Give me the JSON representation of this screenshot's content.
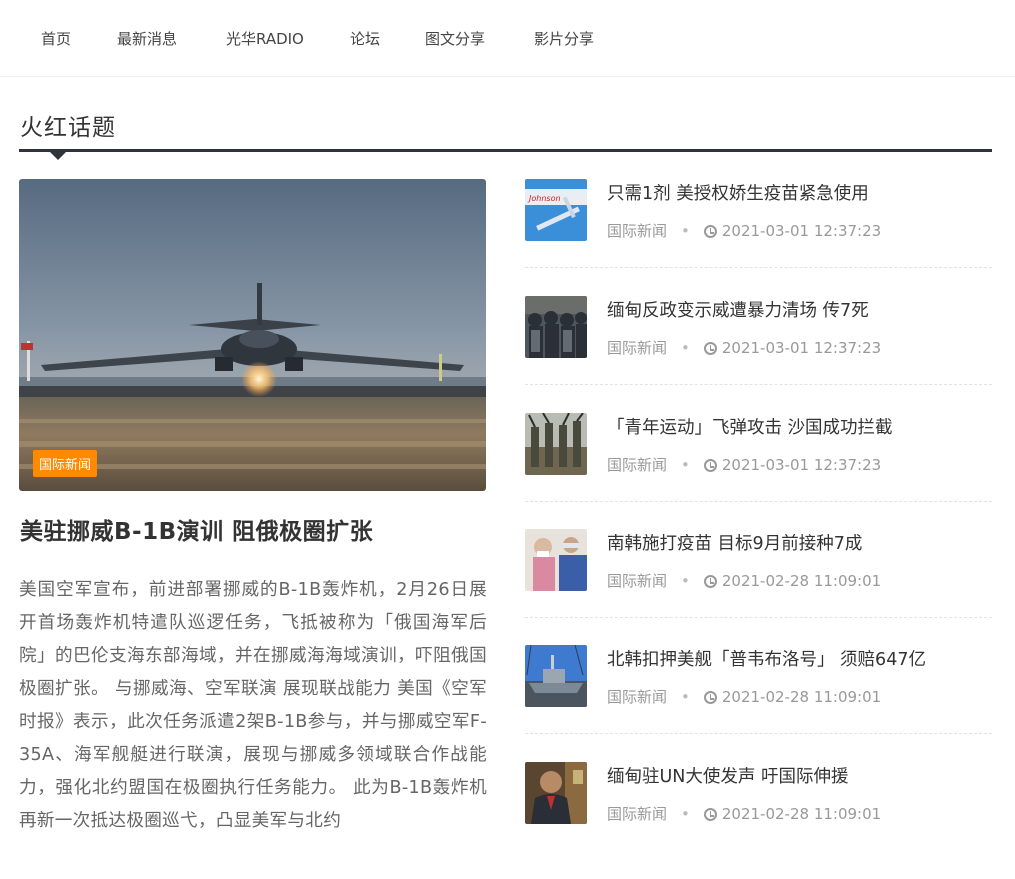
{
  "nav": [
    "首页",
    "最新消息",
    "光华RADIO",
    "论坛",
    "图文分享",
    "影片分享"
  ],
  "section": {
    "title": "火红话题"
  },
  "hero": {
    "badge": "国际新闻",
    "title": "美驻挪威B-1B演训  阻俄极圈扩张",
    "body": "美国空军宣布，前进部署挪威的B-1B轰炸机，2月26日展开首场轰炸机特遣队巡逻任务，飞抵被称为「俄国海军后院」的巴伦支海东部海域，并在挪威海海域演训，吓阻俄国极圈扩张。    与挪威海、空军联演  展现联战能力    美国《空军时报》表示，此次任务派遣2架B-1B参与，并与挪威空军F-35A、海军舰艇进行联演，展现与挪威多领域联合作战能力，强化北约盟国在极圈执行任务能力。    此为B-1B轰炸机再新一次抵达极圈巡弋，凸显美军与北约"
  },
  "news": [
    {
      "title": "只需1剂 美授权娇生疫苗紧急使用",
      "category": "国际新闻",
      "time": "2021-03-01 12:37:23",
      "thumb_icon": "vaccine-syringe-icon"
    },
    {
      "title": "缅甸反政变示威遭暴力清场  传7死",
      "category": "国际新闻",
      "time": "2021-03-01 12:37:23",
      "thumb_icon": "riot-police-icon"
    },
    {
      "title": "「青年运动」飞弹攻击  沙国成功拦截",
      "category": "国际新闻",
      "time": "2021-03-01 12:37:23",
      "thumb_icon": "militants-icon"
    },
    {
      "title": "南韩施打疫苗  目标9月前接种7成",
      "category": "国际新闻",
      "time": "2021-02-28 11:09:01",
      "thumb_icon": "vaccination-icon"
    },
    {
      "title": "北韩扣押美舰「普韦布洛号」 须赔647亿",
      "category": "国际新闻",
      "time": "2021-02-28 11:09:01",
      "thumb_icon": "ship-icon"
    },
    {
      "title": "缅甸驻UN大使发声  吁国际伸援",
      "category": "国际新闻",
      "time": "2021-02-28 11:09:01",
      "thumb_icon": "ambassador-icon"
    }
  ],
  "colors": {
    "badge": "#ff8a00",
    "rule": "#2f333a",
    "meta": "#999999"
  }
}
